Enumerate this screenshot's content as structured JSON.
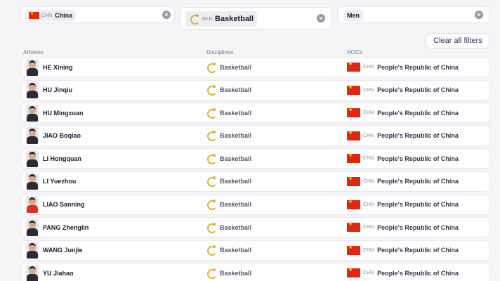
{
  "filters": {
    "noc": {
      "code": "CHN",
      "label": "China"
    },
    "discipline": {
      "code": "BKB",
      "label": "Basketball"
    },
    "gender": {
      "label": "Men"
    },
    "clear_all_label": "Clear all filters"
  },
  "table": {
    "headers": {
      "athletes": "Athletes",
      "disciplines": "Disciplines",
      "nocs": "NOCs"
    },
    "rows": [
      {
        "athlete": "HE Xining",
        "discipline": "Basketball",
        "noc_code": "CHN",
        "noc": "People's Republic of China"
      },
      {
        "athlete": "HU Jinqiu",
        "discipline": "Basketball",
        "noc_code": "CHN",
        "noc": "People's Republic of China"
      },
      {
        "athlete": "HU Mingxuan",
        "discipline": "Basketball",
        "noc_code": "CHN",
        "noc": "People's Republic of China"
      },
      {
        "athlete": "JIAO Boqiao",
        "discipline": "Basketball",
        "noc_code": "CHN",
        "noc": "People's Republic of China"
      },
      {
        "athlete": "LI Hongquan",
        "discipline": "Basketball",
        "noc_code": "CHN",
        "noc": "People's Republic of China"
      },
      {
        "athlete": "LI Yuezhou",
        "discipline": "Basketball",
        "noc_code": "CHN",
        "noc": "People's Republic of China"
      },
      {
        "athlete": "LIAO Sanning",
        "discipline": "Basketball",
        "noc_code": "CHN",
        "noc": "People's Republic of China"
      },
      {
        "athlete": "PANG Zhenglin",
        "discipline": "Basketball",
        "noc_code": "CHN",
        "noc": "People's Republic of China"
      },
      {
        "athlete": "WANG Junjie",
        "discipline": "Basketball",
        "noc_code": "CHN",
        "noc": "People's Republic of China"
      },
      {
        "athlete": "YU Jiahao",
        "discipline": "Basketball",
        "noc_code": "CHN",
        "noc": "People's Republic of China"
      }
    ]
  },
  "icons": {
    "flag": "china-flag-icon",
    "discipline": "basketball-pictogram-icon",
    "clear": "close-circle-icon"
  },
  "colors": {
    "flag_red": "#de2910",
    "flag_star": "#ffde00",
    "discipline_gold": "#d6b640"
  }
}
